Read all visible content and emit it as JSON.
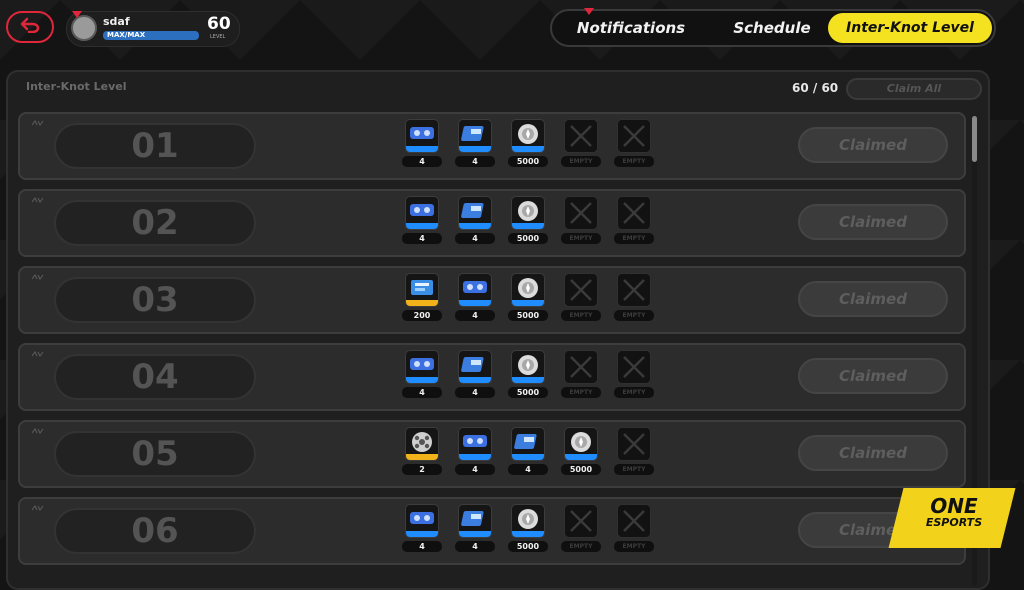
{
  "header": {
    "back_icon": "back-arrow-icon",
    "player": {
      "name": "sdaf",
      "xp_text": "MAX/MAX",
      "level": "60",
      "level_label": "LEVEL"
    },
    "tabs": [
      {
        "label": "Notifications",
        "active": false
      },
      {
        "label": "Schedule",
        "active": false
      },
      {
        "label": "Inter-Knot Level",
        "active": true
      }
    ]
  },
  "panel": {
    "title": "Inter-Knot Level",
    "progress": "60 / 60",
    "claim_all_label": "Claim All"
  },
  "rows": [
    {
      "level": "01",
      "button": "Claimed",
      "rewards": [
        {
          "icon": "blue-card-pack-icon",
          "count": "4",
          "rarity": "blue"
        },
        {
          "icon": "blue-film-icon",
          "count": "4",
          "rarity": "blue"
        },
        {
          "icon": "silver-coin-icon",
          "count": "5000",
          "rarity": "blue"
        },
        {
          "icon": "empty-slot-icon",
          "count": "EMPTY",
          "rarity": "empty"
        },
        {
          "icon": "empty-slot-icon",
          "count": "EMPTY",
          "rarity": "empty"
        }
      ]
    },
    {
      "level": "02",
      "button": "Claimed",
      "rewards": [
        {
          "icon": "blue-card-pack-icon",
          "count": "4",
          "rarity": "blue"
        },
        {
          "icon": "blue-film-icon",
          "count": "4",
          "rarity": "blue"
        },
        {
          "icon": "silver-coin-icon",
          "count": "5000",
          "rarity": "blue"
        },
        {
          "icon": "empty-slot-icon",
          "count": "EMPTY",
          "rarity": "empty"
        },
        {
          "icon": "empty-slot-icon",
          "count": "EMPTY",
          "rarity": "empty"
        }
      ]
    },
    {
      "level": "03",
      "button": "Claimed",
      "rewards": [
        {
          "icon": "gold-ticket-icon",
          "count": "200",
          "rarity": "gold"
        },
        {
          "icon": "blue-card-pack-icon",
          "count": "4",
          "rarity": "blue"
        },
        {
          "icon": "silver-coin-icon",
          "count": "5000",
          "rarity": "blue"
        },
        {
          "icon": "empty-slot-icon",
          "count": "EMPTY",
          "rarity": "empty"
        },
        {
          "icon": "empty-slot-icon",
          "count": "EMPTY",
          "rarity": "empty"
        }
      ]
    },
    {
      "level": "04",
      "button": "Claimed",
      "rewards": [
        {
          "icon": "blue-card-pack-icon",
          "count": "4",
          "rarity": "blue"
        },
        {
          "icon": "blue-film-icon",
          "count": "4",
          "rarity": "blue"
        },
        {
          "icon": "silver-coin-icon",
          "count": "5000",
          "rarity": "blue"
        },
        {
          "icon": "empty-slot-icon",
          "count": "EMPTY",
          "rarity": "empty"
        },
        {
          "icon": "empty-slot-icon",
          "count": "EMPTY",
          "rarity": "empty"
        }
      ]
    },
    {
      "level": "05",
      "button": "Claimed",
      "rewards": [
        {
          "icon": "film-reel-icon",
          "count": "2",
          "rarity": "gold"
        },
        {
          "icon": "blue-card-pack-icon",
          "count": "4",
          "rarity": "blue"
        },
        {
          "icon": "blue-film-icon",
          "count": "4",
          "rarity": "blue"
        },
        {
          "icon": "silver-coin-icon",
          "count": "5000",
          "rarity": "blue"
        },
        {
          "icon": "empty-slot-icon",
          "count": "EMPTY",
          "rarity": "empty"
        }
      ]
    },
    {
      "level": "06",
      "button": "Claimed",
      "rewards": [
        {
          "icon": "blue-card-pack-icon",
          "count": "4",
          "rarity": "blue"
        },
        {
          "icon": "blue-film-icon",
          "count": "4",
          "rarity": "blue"
        },
        {
          "icon": "silver-coin-icon",
          "count": "5000",
          "rarity": "blue"
        },
        {
          "icon": "empty-slot-icon",
          "count": "EMPTY",
          "rarity": "empty"
        },
        {
          "icon": "empty-slot-icon",
          "count": "EMPTY",
          "rarity": "empty"
        }
      ]
    }
  ],
  "watermark": {
    "line1": "ONE",
    "line2": "ESPORTS"
  },
  "colors": {
    "accent_yellow": "#f4e11f",
    "alert_red": "#e0263b",
    "reward_blue": "#1f8cff",
    "reward_gold": "#f2b21a"
  }
}
